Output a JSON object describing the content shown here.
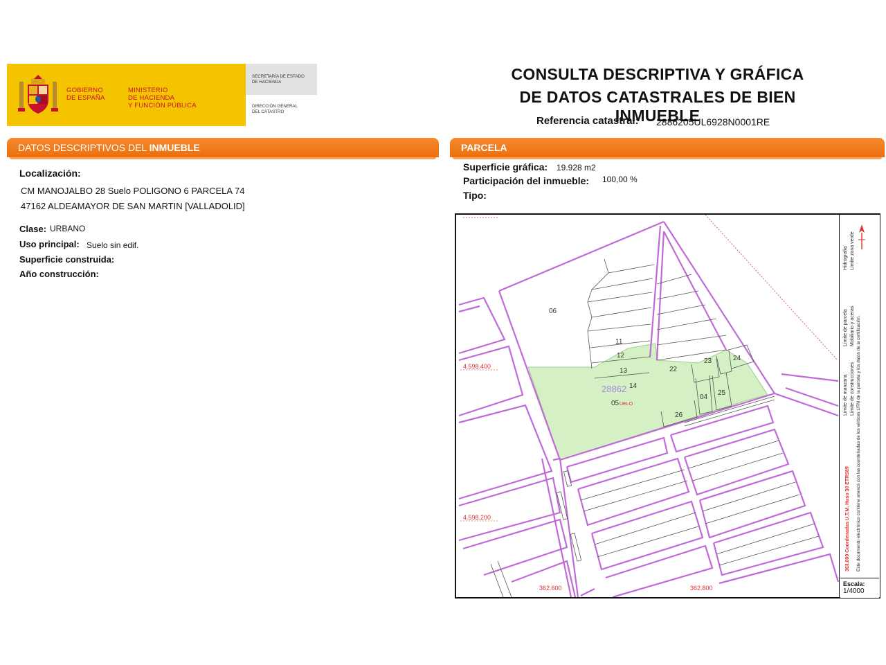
{
  "header": {
    "gov_line1": "GOBIERNO",
    "gov_line2": "DE ESPAÑA",
    "ministry_line1": "MINISTERIO",
    "ministry_line2": "DE HACIENDA",
    "ministry_line3": "Y FUNCIÓN PÚBLICA",
    "secretaria_line1": "SECRETARÍA DE ESTADO",
    "secretaria_line2": "DE HACIENDA",
    "direccion_line1": "DIRECCIÓN GENERAL",
    "direccion_line2": "DEL CATASTRO",
    "title_line1": "CONSULTA DESCRIPTIVA Y GRÁFICA",
    "title_line2": "DE DATOS CATASTRALES DE BIEN INMUEBLE",
    "ref_label": "Referencia catastral:",
    "ref_value": "2886205UL6928N0001RE"
  },
  "left_section": {
    "bar_title_prefix": "DATOS DESCRIPTIVOS DEL ",
    "bar_title_bold": "INMUEBLE",
    "localizacion_label": "Localización:",
    "address_line1": "CM MANOJALBO 28 Suelo POLIGONO 6 PARCELA 74",
    "address_line2": "47162 ALDEAMAYOR DE SAN MARTIN [VALLADOLID]",
    "clase_label": "Clase:",
    "clase_value": "URBANO",
    "uso_label": "Uso principal:",
    "uso_value": "Suelo sin edif.",
    "superficie_construida_label": "Superficie construida:",
    "anio_label": "Año construcción:"
  },
  "right_section": {
    "bar_title": "PARCELA",
    "superficie_grafica_label": "Superficie gráfica:",
    "superficie_grafica_value": "19.928 m2",
    "participacion_label": "Participación del inmueble:",
    "participacion_value": "100,00 %",
    "tipo_label": "Tipo:"
  },
  "map": {
    "parcel_labels": [
      "06",
      "11",
      "12",
      "13",
      "14",
      "22",
      "23",
      "24",
      "04",
      "25",
      "26"
    ],
    "parcel_ref": "28862",
    "parcel_05": "05",
    "suelo": "UELO",
    "y_coord_1": "4.598.400",
    "y_coord_2": "4.598.200",
    "x_coord_1": "362.600",
    "x_coord_2": "362.800",
    "legend_col1_a": "Límite de manzana",
    "legend_col1_b": "Límite de parcela",
    "legend_col1_c": "Hidrografía",
    "legend_col2_a": "Límite de construcciones",
    "legend_col2_b": "Mobiliario y aceras",
    "legend_col2_c": "Límite zona verde",
    "coord_note": "363.000 Coordenadas U.T.M. Huso 30 ETRS89",
    "footnote": "Este documento electrónico contiene anexos con las coordenadas de los vértices UTM de la parcela y los datos de la certificación.",
    "scale_label": "Escala:",
    "scale_value": "1/4000",
    "colors": {
      "parcel_fill": "#d4f0c4",
      "block_line": "#c06ad8",
      "coord_text": "#e03030"
    }
  }
}
